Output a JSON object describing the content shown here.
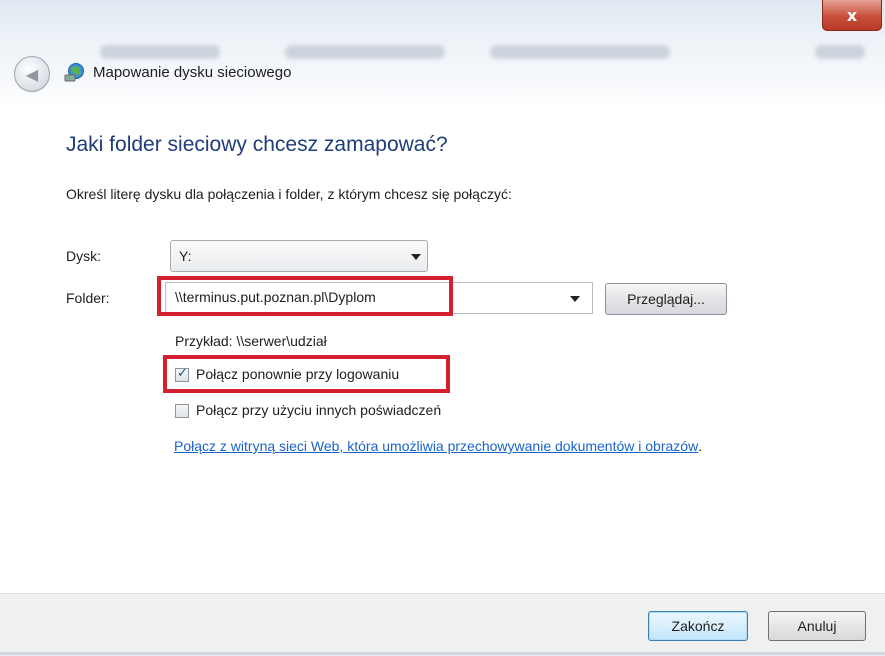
{
  "window": {
    "title": "Mapowanie dysku sieciowego",
    "close_glyph": "x"
  },
  "icons": {
    "back": "back-arrow-icon",
    "app": "network-drive-icon",
    "close": "close-icon"
  },
  "main": {
    "heading": "Jaki folder sieciowy chcesz zamapować?",
    "instruction": "Określ literę dysku dla połączenia i folder, z którym chcesz się połączyć:",
    "drive_label": "Dysk:",
    "drive_value": "Y:",
    "folder_label": "Folder:",
    "folder_value": "\\\\terminus.put.poznan.pl\\Dyplom",
    "browse_label": "Przeglądaj...",
    "example_text": "Przykład: \\\\serwer\\udział",
    "reconnect_label": "Połącz ponownie przy logowaniu",
    "reconnect_checked": true,
    "other_credentials_label": "Połącz przy użyciu innych poświadczeń",
    "other_credentials_checked": false,
    "weblink_text": "Połącz z witryną sieci Web, która umożliwia przechowywanie dokumentów i obrazów",
    "weblink_suffix": "."
  },
  "footer": {
    "finish_label": "Zakończ",
    "cancel_label": "Anuluj"
  },
  "colors": {
    "heading": "#1f3d7a",
    "link": "#1a63c9",
    "highlight_box": "#d4202f",
    "close_button": "#c9503c"
  }
}
